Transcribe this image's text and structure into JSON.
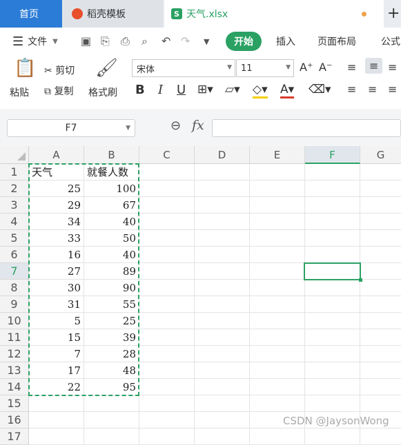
{
  "tabs": [
    {
      "label": "首页"
    },
    {
      "label": "稻壳模板"
    },
    {
      "label": "天气.xlsx",
      "icon": "S"
    }
  ],
  "menu": {
    "file": "文件",
    "items": [
      "开始",
      "插入",
      "页面布局",
      "公式"
    ]
  },
  "ribbon": {
    "paste": "粘贴",
    "cut": "剪切",
    "copy": "复制",
    "format_painter": "格式刷",
    "font_name": "宋体",
    "font_size": "11",
    "bold": "B",
    "italic": "I",
    "underline": "U"
  },
  "formula_bar": {
    "name_box": "F7",
    "fx": "fx",
    "formula": ""
  },
  "columns": [
    "A",
    "B",
    "C",
    "D",
    "E",
    "F",
    "G"
  ],
  "selected_column": "F",
  "selected_row": "7",
  "rows": [
    {
      "n": "1",
      "a": "天气",
      "b": "就餐人数"
    },
    {
      "n": "2",
      "a": "25",
      "b": "100"
    },
    {
      "n": "3",
      "a": "29",
      "b": "67"
    },
    {
      "n": "4",
      "a": "34",
      "b": "40"
    },
    {
      "n": "5",
      "a": "33",
      "b": "50"
    },
    {
      "n": "6",
      "a": "16",
      "b": "40"
    },
    {
      "n": "7",
      "a": "27",
      "b": "89"
    },
    {
      "n": "8",
      "a": "30",
      "b": "90"
    },
    {
      "n": "9",
      "a": "31",
      "b": "55"
    },
    {
      "n": "10",
      "a": "5",
      "b": "25"
    },
    {
      "n": "11",
      "a": "15",
      "b": "39"
    },
    {
      "n": "12",
      "a": "7",
      "b": "28"
    },
    {
      "n": "13",
      "a": "17",
      "b": "48"
    },
    {
      "n": "14",
      "a": "22",
      "b": "95"
    },
    {
      "n": "15",
      "a": "",
      "b": ""
    },
    {
      "n": "16",
      "a": "",
      "b": ""
    },
    {
      "n": "17",
      "a": "",
      "b": ""
    }
  ],
  "watermark": "CSDN @JaysonWong",
  "colors": {
    "accent": "#2aa163",
    "home_tab": "#2b7cd6"
  }
}
